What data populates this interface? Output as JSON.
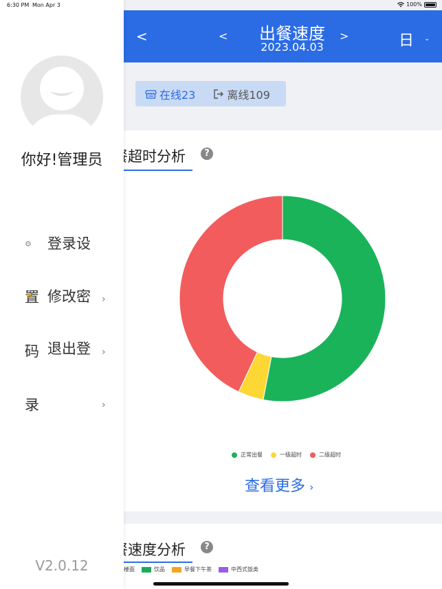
{
  "status_bar": {
    "time": "6:30 PM",
    "date": "Mon Apr 3",
    "battery": "100%"
  },
  "header": {
    "back": "<",
    "prev": "<",
    "next": ">",
    "title": "出餐速度",
    "date": "2023.04.03",
    "period": "日",
    "period_caret": "⌄"
  },
  "store_status": {
    "online": "在线23",
    "offline": "离线109"
  },
  "timeout_analysis": {
    "title": "餐超时分析",
    "help": "?",
    "more": "查看更多",
    "more_chevron": "›"
  },
  "speed_analysis": {
    "title": "餐速度分析",
    "help": "?",
    "legend": [
      {
        "name": "楼面",
        "color": ""
      },
      {
        "name": "饮品",
        "color": "#1aab5a"
      },
      {
        "name": "早餐下午茶",
        "color": "#f4a524"
      },
      {
        "name": "中西式饭类",
        "color": "#9b5de5"
      }
    ]
  },
  "chart_data": {
    "type": "pie",
    "donut": true,
    "categories": [
      "正常出餐",
      "一级超时",
      "二级超时"
    ],
    "values": [
      53,
      4,
      43
    ],
    "colors": [
      "#1ab35a",
      "#fdd835",
      "#f25c5c"
    ],
    "legend_position": "bottom-center"
  },
  "sidebar": {
    "greeting": "你好!管理员",
    "gear_glyph": "⚙",
    "lock_glyph": "🔒",
    "exit_glyph": "⎋",
    "menu": [
      {
        "text": "登录设"
      },
      {
        "text": "置"
      },
      {
        "text": "修改密"
      },
      {
        "text": "码"
      },
      {
        "text": "退出登"
      },
      {
        "text": "录"
      }
    ],
    "chevron": "›",
    "version": "V2.0.12"
  }
}
